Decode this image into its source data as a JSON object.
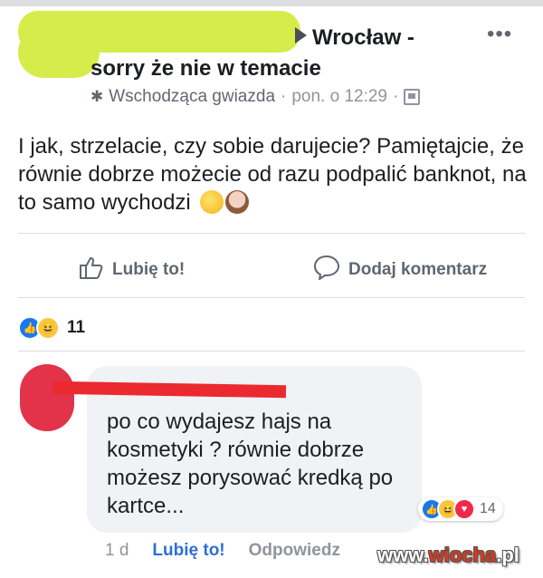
{
  "post": {
    "group_name": "Wrocław -",
    "group_name_cont": "sorry że nie w temacie",
    "badge": "Wschodząca gwiazda",
    "separator": "·",
    "time": "pon. o 12:29",
    "text": "I jak, strzelacie, czy sobie darujecie? Pamiętajcie, że równie dobrze możecie od razu podpalić banknot, na to samo wychodzi",
    "more_label": "•••",
    "icons": {
      "privacy": "group-privacy-icon",
      "badge": "star-badge-icon",
      "emoji1": "smiling-face-emoji",
      "emoji2": "woman-tipping-hand-emoji"
    }
  },
  "actions": {
    "like_label": "Lubię to!",
    "comment_label": "Dodaj komentarz"
  },
  "reactions": {
    "count": "11",
    "types": [
      "like",
      "haha"
    ]
  },
  "comment": {
    "text": "po co wydajesz hajs na kosmetyki ? równie dobrze możesz porysować kredką po kartce...",
    "reaction_count": "14",
    "reaction_types": [
      "like",
      "haha",
      "love"
    ],
    "time": "1 d",
    "like_label": "Lubię to!",
    "reply_label": "Odpowiedz"
  },
  "watermark": {
    "prefix": "www.",
    "accent": "wiocha",
    "suffix": ".pl"
  },
  "colors": {
    "accent_blue": "#1877f2",
    "like_text": "#2f6fd3",
    "redaction_green": "#d6ec4a",
    "redaction_red": "#ea2a2f"
  }
}
